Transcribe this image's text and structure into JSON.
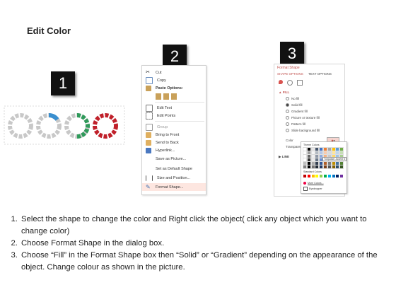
{
  "page": {
    "title": "Edit Color"
  },
  "badges": [
    "1",
    "2",
    "3"
  ],
  "rings": [
    {
      "color": "#c8c8c8",
      "accent": ""
    },
    {
      "color": "#c8c8c8",
      "accent": "#3a8fcf"
    },
    {
      "color": "#c8c8c8",
      "accent": "#2f9a5a"
    },
    {
      "color": "#c0202a",
      "accent": "#c0202a"
    }
  ],
  "context_menu": {
    "items": [
      {
        "label": "Cut",
        "icon": "scissors-icon"
      },
      {
        "label": "Copy",
        "icon": "copy-icon"
      },
      {
        "label": "Paste Options:",
        "icon": "paste-icon"
      },
      {
        "label": "",
        "icon": "paste-options-icon"
      },
      {
        "label": "Edit Text",
        "icon": "edit-text-icon"
      },
      {
        "label": "Edit Points",
        "icon": "edit-points-icon"
      },
      {
        "label": "Group",
        "icon": "group-icon"
      },
      {
        "label": "Bring to Front",
        "icon": "bring-front-icon"
      },
      {
        "label": "Send to Back",
        "icon": "send-back-icon"
      },
      {
        "label": "Hyperlink...",
        "icon": "hyperlink-icon"
      },
      {
        "label": "Save as Picture...",
        "icon": ""
      },
      {
        "label": "Set as Default Shape",
        "icon": ""
      },
      {
        "label": "Size and Position...",
        "icon": "size-position-icon"
      },
      {
        "label": "Format Shape...",
        "icon": "format-shape-icon"
      }
    ]
  },
  "format_pane": {
    "title": "Format Shape",
    "tabs": [
      "SHAPE OPTIONS",
      "TEXT OPTIONS"
    ],
    "section_fill": "FILL",
    "options": [
      "No fill",
      "Solid fill",
      "Gradient fill",
      "Picture or texture fill",
      "Pattern fill",
      "Slide background fill"
    ],
    "color_label": "Color",
    "transparency_label": "Transparency",
    "section_line": "LINE"
  },
  "palette": {
    "theme_label": "Theme Colors",
    "tooltip": "Turquoise, Accent 5",
    "standard_label": "Standard Colors",
    "more_colors": "More Colors...",
    "eyedropper": "Eyedropper",
    "theme_row": [
      "#ffffff",
      "#000000",
      "#e7e6e6",
      "#44546a",
      "#4472c4",
      "#ed7d31",
      "#a5a5a5",
      "#ffc000",
      "#5b9bd5",
      "#70ad47"
    ],
    "standard_row": [
      "#c00000",
      "#ff0000",
      "#ffc000",
      "#ffff00",
      "#92d050",
      "#00b050",
      "#00b0f0",
      "#0070c0",
      "#002060",
      "#7030a0"
    ]
  },
  "instructions": [
    "Select the shape to change the color and Right click the object( click any object which you want to change color)",
    "Choose Format Shape in the dialog box.",
    "Choose “Fill” in the Format Shape box then “Solid” or “Gradient” depending on the appearance of the object. Change colour as shown in the picture."
  ]
}
